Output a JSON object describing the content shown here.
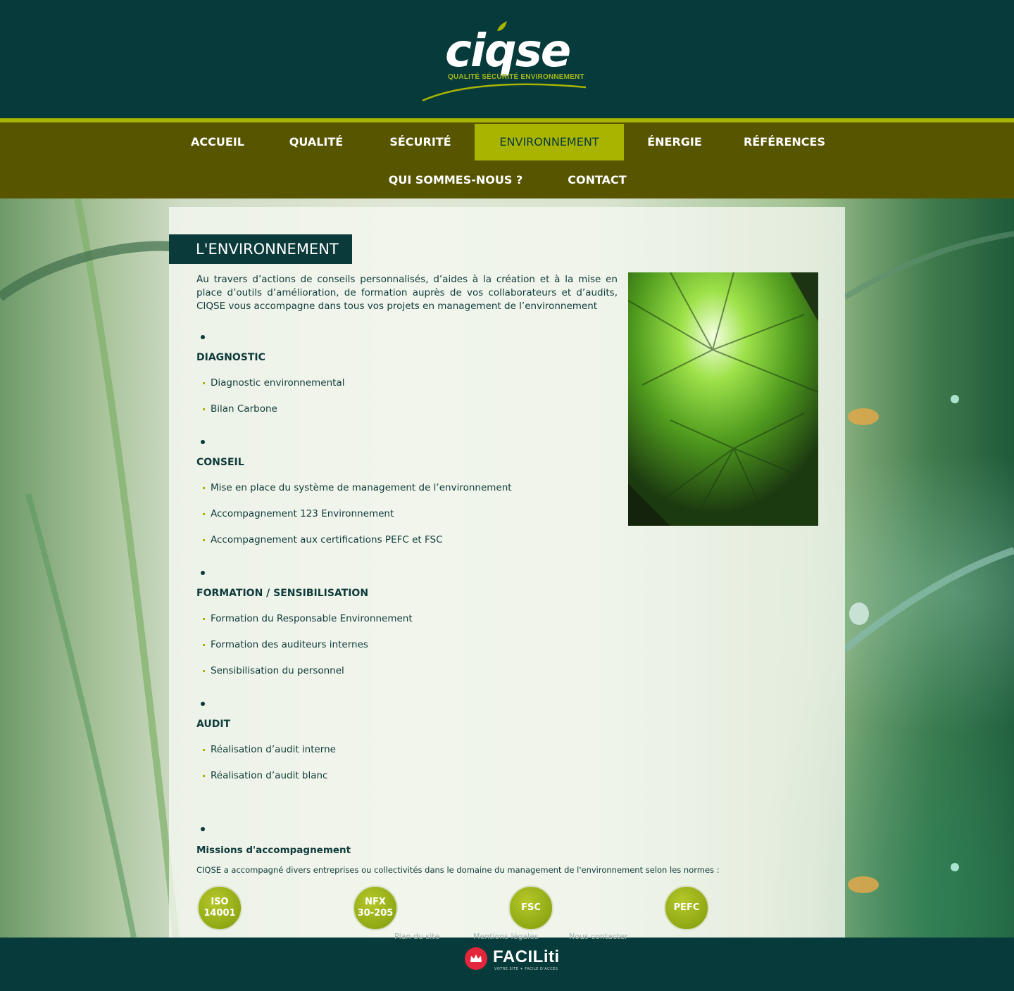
{
  "header": {
    "logo_word": "ciqse",
    "logo_tagline": "QUALITÉ SÉCURITÉ ENVIRONNEMENT"
  },
  "nav": {
    "items": [
      {
        "label": "ACCUEIL"
      },
      {
        "label": "QUALITÉ"
      },
      {
        "label": "SÉCURITÉ"
      },
      {
        "label": "ENVIRONNEMENT",
        "active": true
      },
      {
        "label": "ÉNERGIE"
      },
      {
        "label": "RÉFÉRENCES"
      },
      {
        "label": "QUI SOMMES-NOUS ?"
      },
      {
        "label": "CONTACT"
      }
    ]
  },
  "main": {
    "title": "L'ENVIRONNEMENT",
    "intro": "Au travers d’actions de conseils personnalisés, d’aides à la création et à la mise en place d’outils d’amélioration, de formation auprès de vos collaborateurs et d’audits, CIQSE vous accompagne dans tous vos projets en management de l’environnement",
    "sections": [
      {
        "title": "DIAGNOSTIC",
        "items": [
          "Diagnostic environnemental",
          "Bilan Carbone"
        ]
      },
      {
        "title": "CONSEIL",
        "items": [
          "Mise en place du système de management de l’environnement",
          "Accompagnement 123 Environnement",
          "Accompagnement aux certifications PEFC et FSC"
        ]
      },
      {
        "title": "FORMATION / SENSIBILISATION",
        "items": [
          "Formation du Responsable Environnement",
          "Formation des auditeurs internes",
          "Sensibilisation du personnel"
        ]
      },
      {
        "title": "AUDIT",
        "items": [
          "Réalisation d’audit interne",
          "Réalisation d’audit blanc"
        ]
      }
    ],
    "missions_title": "Missions d'accompagnement",
    "missions_text": "CIQSE a accompagné divers entreprises ou collectivités dans le domaine du management de l'environnement selon les normes :",
    "badges": [
      {
        "line1": "ISO",
        "line2": "14001"
      },
      {
        "line1": "NFX",
        "line2": "30-205"
      },
      {
        "line1": "FSC",
        "line2": ""
      },
      {
        "line1": "PEFC",
        "line2": ""
      }
    ]
  },
  "footer": {
    "links": [
      "Plan du site",
      "Mentions légales",
      "Nous contacter"
    ],
    "faciliti_name": "FACILiti",
    "faciliti_tagline": "VOTRE SITE ✦ FACILE D'ACCÈS"
  },
  "colors": {
    "header_bg": "#073b3b",
    "nav_bg": "#585500",
    "accent": "#a8b400"
  }
}
